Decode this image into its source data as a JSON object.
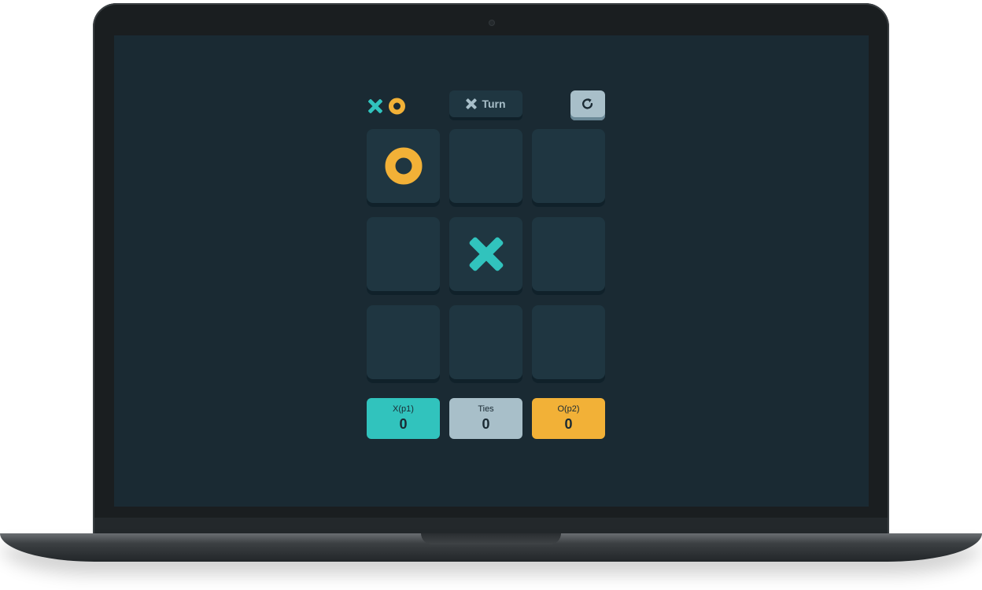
{
  "colors": {
    "x": "#31c3bd",
    "o": "#f2b137",
    "ties": "#a8bfc9",
    "cell": "#1f3641",
    "background": "#1a2a33"
  },
  "header": {
    "turn_label": "Turn",
    "turn_icon": "x-icon",
    "reset_icon": "restart-icon"
  },
  "board": {
    "cells": [
      "O",
      "",
      "",
      "",
      "X",
      "",
      "",
      "",
      ""
    ]
  },
  "scores": {
    "x": {
      "label": "X(p1)",
      "value": "0"
    },
    "ties": {
      "label": "Ties",
      "value": "0"
    },
    "o": {
      "label": "O(p2)",
      "value": "0"
    }
  }
}
